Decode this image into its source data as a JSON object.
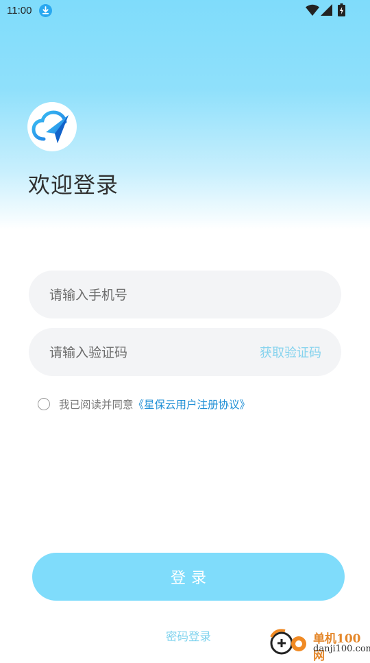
{
  "status_bar": {
    "time": "11:00"
  },
  "header": {
    "title": "欢迎登录"
  },
  "form": {
    "phone_placeholder": "请输入手机号",
    "code_placeholder": "请输入验证码",
    "get_code_label": "获取验证码"
  },
  "agreement": {
    "text": "我已阅读并同意",
    "link": "《星保云用户注册协议》",
    "checked": false
  },
  "actions": {
    "login_label": "登录",
    "password_login_label": "密码登录"
  },
  "watermark": {
    "title": "单机100网",
    "url": "danji100.com"
  },
  "icons": {
    "download": "download-icon",
    "wifi": "wifi-icon",
    "signal": "signal-icon",
    "battery": "battery-icon",
    "logo": "cloud-paper-plane-logo"
  },
  "colors": {
    "accent": "#7fdcfb",
    "link": "#1f8fd6",
    "get_code": "#86d3ee",
    "field_bg": "#f3f4f6"
  }
}
